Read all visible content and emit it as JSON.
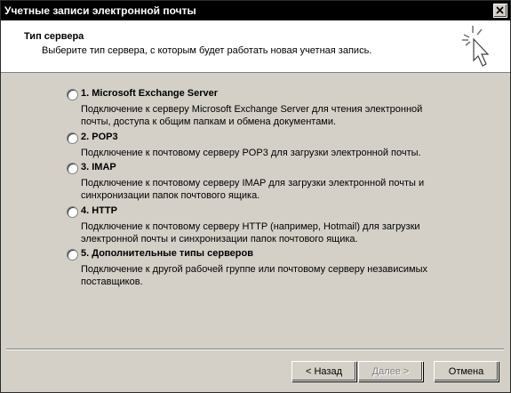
{
  "window": {
    "title": "Учетные записи электронной почты"
  },
  "header": {
    "title": "Тип сервера",
    "subtitle": "Выберите тип сервера, с которым будет работать новая учетная запись."
  },
  "options": [
    {
      "label": "1. Microsoft Exchange Server",
      "description": "Подключение к серверу Microsoft Exchange Server для чтения электронной почты, доступа к общим папкам и обмена документами.",
      "selected": false
    },
    {
      "label": "2. POP3",
      "description": "Подключение к почтовому серверу POP3 для загрузки электронной почты.",
      "selected": false
    },
    {
      "label": "3. IMAP",
      "description": "Подключение к почтовому серверу IMAP для загрузки электронной почты и синхронизации папок почтового ящика.",
      "selected": false
    },
    {
      "label": "4. HTTP",
      "description": "Подключение к почтовому серверу HTTP (например, Hotmail) для загрузки электронной почты и синхронизации папок почтового ящика.",
      "selected": false
    },
    {
      "label": "5. Дополнительные типы серверов",
      "description": "Подключение к другой рабочей группе или почтовому серверу независимых поставщиков.",
      "selected": false
    }
  ],
  "buttons": {
    "back": "< Назад",
    "next": "Далее >",
    "cancel": "Отмена"
  },
  "icons": {
    "close": "close-icon",
    "wizard": "cursor-sparkle-icon"
  },
  "colors": {
    "titlebar": "#000000",
    "face": "#d4d0c8",
    "header_bg": "#ffffff"
  }
}
